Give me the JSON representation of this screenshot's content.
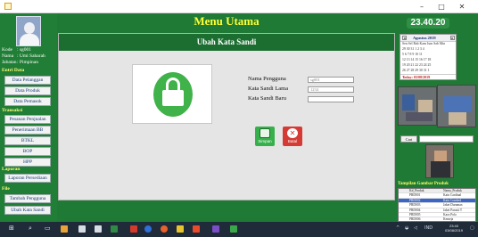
{
  "window": {
    "minimize": "–",
    "maximize": "□",
    "close": "✕"
  },
  "banner": {
    "title": "Menu Utama"
  },
  "user": {
    "kode_label": "Kode",
    "kode_value": ": sg001",
    "nama_label": "Nama",
    "nama_value": ": Umi Saharah",
    "jabatan_label": "Jabatan",
    "jabatan_value": ": Pimpinan"
  },
  "sidebar": {
    "entri_label": "Entri Data",
    "entri_items": [
      "Data Pelanggan",
      "Data Produk",
      "Data Pemasok"
    ],
    "transaksi_label": "Transaksi",
    "transaksi_items": [
      "Pesanan Penjualan",
      "Penerimaan BB",
      "BTKL",
      "BOP",
      "HPP"
    ],
    "laporan_label": "Laporan",
    "laporan_items": [
      "Laporan Persediaan"
    ],
    "file_label": "File",
    "file_items": [
      "Tambah Pengguna",
      "Ubah Kata Sandi"
    ]
  },
  "panel": {
    "title": "Ubah Kata Sandi",
    "labels": {
      "nama_pengguna": "Nama Pengguna",
      "kata_sandi_lama": "Kata Sandi Lama",
      "kata_sandi_baru": "Kata Sandi Baru"
    },
    "values": {
      "nama_pengguna": "sg001",
      "kata_sandi_lama": "1234",
      "kata_sandi_baru": ""
    },
    "simpan_label": "Simpan",
    "batal_label": "Batal",
    "simpan_icon": "save-icon",
    "batal_icon": "cancel-icon"
  },
  "right": {
    "clock": "23.40.20",
    "calendar": {
      "month": "Agustus 2019",
      "rows": [
        "Sen Sel Rab Kam Jum Sab Min",
        "29  30  31   1   2   3   4",
        " 5   6   7   8   9  10  11",
        "12  13  14  15  16  17  18",
        "19  20  21  22  23  24  25",
        "26  27  28  29  30  31   1",
        " 2   3   4   5   6   7   8"
      ],
      "today": "Today: 03/08/2019"
    },
    "cari_label": "Cari",
    "gallery_label": "Tampilan Gambar Produk",
    "grid_headers": [
      "Kd_Produk",
      "Nama_Produk"
    ],
    "grid_rows": [
      [
        "PRD001",
        "Kain Cardinal"
      ],
      [
        "PRD002",
        "Kain Combed"
      ],
      [
        "PRD003",
        "Jaket Duramax"
      ],
      [
        "PRD004",
        "Jaket Parasit T"
      ],
      [
        "PRD005",
        "Kaos Polo"
      ],
      [
        "PRD006",
        "Kemeja"
      ]
    ]
  },
  "taskbar": {
    "time": "23:40",
    "date": "03/08/2019",
    "lang": "IND",
    "start_icon": "windows-start-icon",
    "search_icon": "search-icon"
  },
  "colors": {
    "app_bg": "#1e7a34",
    "banner_text": "#ffff33",
    "panel_bg": "#e5e5e5",
    "lock_green": "#3fb24a",
    "save_btn": "#35b04a",
    "cancel_btn": "#e0413a",
    "taskbar": "#1f2b38"
  }
}
